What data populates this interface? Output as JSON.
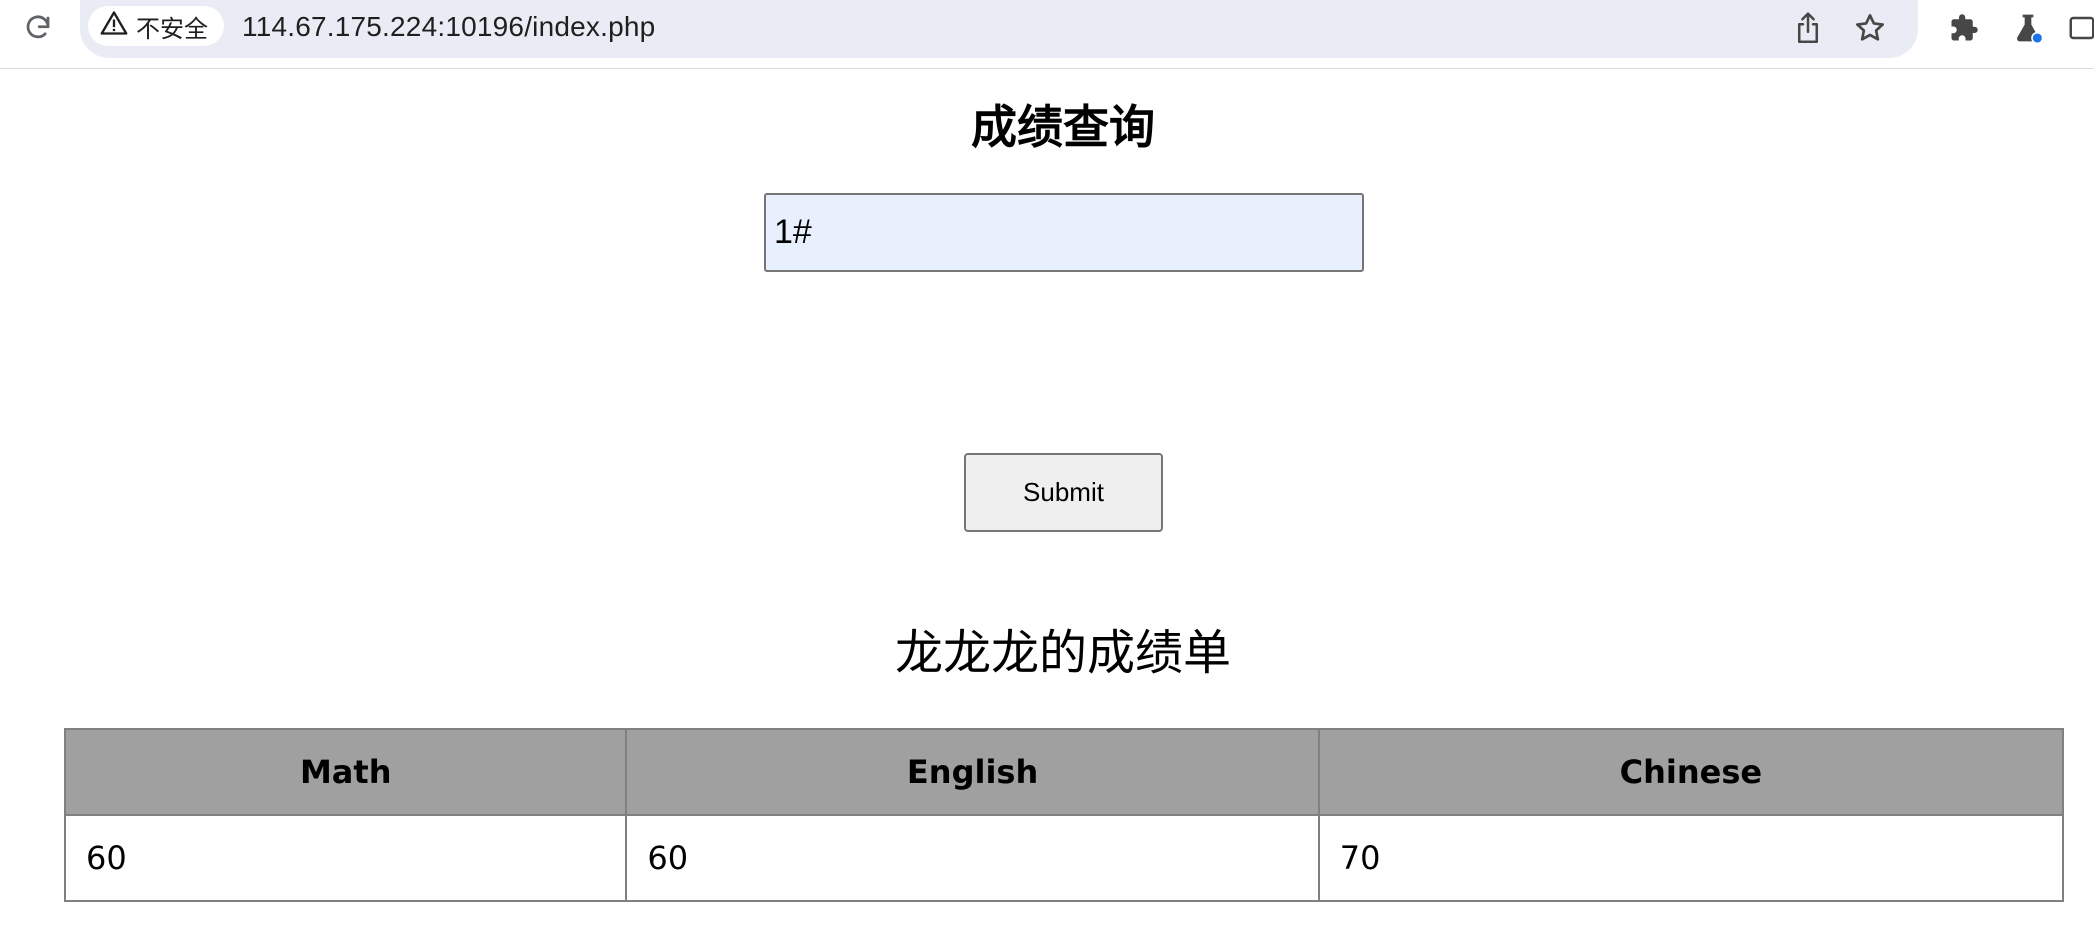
{
  "browser": {
    "security_label": "不安全",
    "url": "114.67.175.224:10196/index.php"
  },
  "page": {
    "title": "成绩查询",
    "query_value": "1#",
    "submit_label": "Submit",
    "caption": "龙龙龙的成绩单"
  },
  "table": {
    "headers": [
      "Math",
      "English",
      "Chinese"
    ],
    "rows": [
      [
        "60",
        "60",
        "70"
      ]
    ]
  }
}
